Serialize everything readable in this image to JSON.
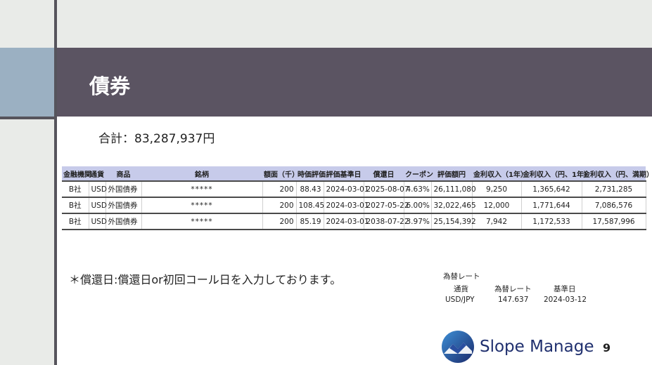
{
  "title": "債券",
  "total": "合計：83,287,937円",
  "table": {
    "headers": [
      "金融機関",
      "通貨",
      "商品",
      "銘柄",
      "額面（千）",
      "時価評価",
      "評価基準日",
      "償還日",
      "クーポン",
      "評価額円",
      "金利収入（1年）",
      "金利収入（円、1年）",
      "金利収入（円、満期）"
    ],
    "rows": [
      [
        "B社",
        "USD",
        "外国債券",
        "*****",
        "200",
        "88.43",
        "2024-03-01",
        "2025-08-07",
        "4.63%",
        "26,111,080",
        "9,250",
        "1,365,642",
        "2,731,285"
      ],
      [
        "B社",
        "USD",
        "外国債券",
        "*****",
        "200",
        "108.45",
        "2024-03-01",
        "2027-05-22",
        "6.00%",
        "32,022,465",
        "12,000",
        "1,771,644",
        "7,086,576"
      ],
      [
        "B社",
        "USD",
        "外国債券",
        "*****",
        "200",
        "85.19",
        "2024-03-01",
        "2038-07-22",
        "3.97%",
        "25,154,392",
        "7,942",
        "1,172,533",
        "17,587,996"
      ]
    ]
  },
  "note": "＊償還日:償還日or初回コール日を入力しております。",
  "fx": {
    "title": "為替レート",
    "headers": [
      "通貨",
      "為替レート",
      "基準日"
    ],
    "values": [
      "USD/JPY",
      "147.637",
      "2024-03-12"
    ]
  },
  "brand": "Slope Manage",
  "page_number": "9",
  "colors": {
    "title_bar": "#5b5462",
    "accent_block": "#9bb0c2",
    "table_header": "#c7cbea",
    "brand_text": "#1f2f6e"
  },
  "icons": {
    "logo": "mountain-logo-icon"
  }
}
